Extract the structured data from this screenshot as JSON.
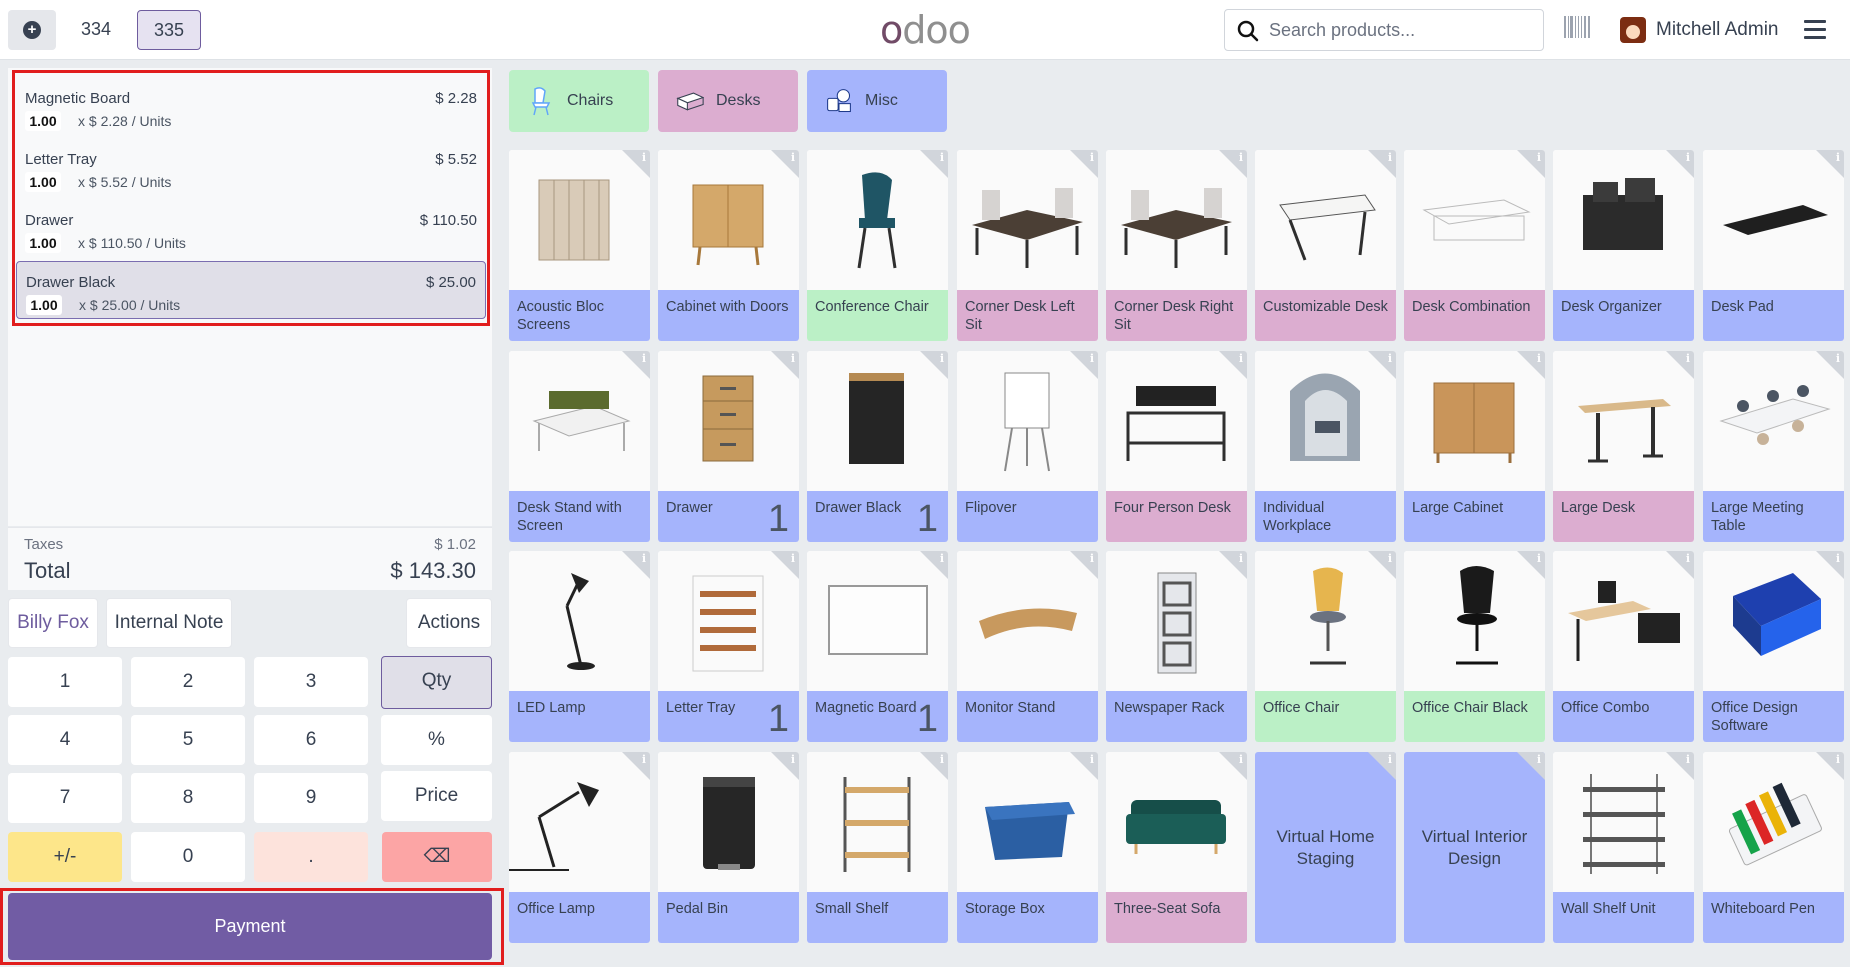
{
  "header": {
    "order_tabs": [
      "334",
      "335"
    ],
    "active_order": "335",
    "logo": "odoo",
    "search_placeholder": "Search products...",
    "user_name": "Mitchell Admin"
  },
  "order_lines": [
    {
      "name": "Magnetic Board",
      "price": "$ 2.28",
      "qty": "1.00",
      "unit_price": "x $ 2.28 / Units",
      "selected": false
    },
    {
      "name": "Letter Tray",
      "price": "$ 5.52",
      "qty": "1.00",
      "unit_price": "x $ 5.52 / Units",
      "selected": false
    },
    {
      "name": "Drawer",
      "price": "$ 110.50",
      "qty": "1.00",
      "unit_price": "x $ 110.50 / Units",
      "selected": false
    },
    {
      "name": "Drawer Black",
      "price": "$ 25.00",
      "qty": "1.00",
      "unit_price": "x $ 25.00 / Units",
      "selected": true
    }
  ],
  "totals": {
    "taxes_label": "Taxes",
    "taxes_value": "$ 1.02",
    "total_label": "Total",
    "total_value": "$ 143.30"
  },
  "controls": {
    "customer": "Billy Fox",
    "internal_note": "Internal Note",
    "actions": "Actions"
  },
  "numpad": {
    "k1": "1",
    "k2": "2",
    "k3": "3",
    "qty": "Qty",
    "k4": "4",
    "k5": "5",
    "k6": "6",
    "percent": "%",
    "k7": "7",
    "k8": "8",
    "k9": "9",
    "price": "Price",
    "plusminus": "+/-",
    "k0": "0",
    "dot": ".",
    "backspace": "⌫"
  },
  "payment_label": "Payment",
  "categories": [
    {
      "name": "Chairs",
      "color": "#bbf0c6"
    },
    {
      "name": "Desks",
      "color": "#dcadd0"
    },
    {
      "name": "Misc",
      "color": "#a5b4fc"
    }
  ],
  "products": [
    {
      "name": "Acoustic Bloc Screens",
      "color": "#a5b4fc"
    },
    {
      "name": "Cabinet with Doors",
      "color": "#a5b4fc"
    },
    {
      "name": "Conference Chair",
      "color": "#bbf0c6"
    },
    {
      "name": "Corner Desk Left Sit",
      "color": "#dcadd0"
    },
    {
      "name": "Corner Desk Right Sit",
      "color": "#dcadd0"
    },
    {
      "name": "Customizable Desk",
      "color": "#dcadd0"
    },
    {
      "name": "Desk Combination",
      "color": "#dcadd0"
    },
    {
      "name": "Desk Organizer",
      "color": "#a5b4fc"
    },
    {
      "name": "Desk Pad",
      "color": "#a5b4fc"
    },
    {
      "name": "Desk Stand with Screen",
      "color": "#a5b4fc"
    },
    {
      "name": "Drawer",
      "color": "#a5b4fc",
      "count": "1"
    },
    {
      "name": "Drawer Black",
      "color": "#a5b4fc",
      "count": "1"
    },
    {
      "name": "Flipover",
      "color": "#a5b4fc"
    },
    {
      "name": "Four Person Desk",
      "color": "#dcadd0"
    },
    {
      "name": "Individual Workplace",
      "color": "#a5b4fc"
    },
    {
      "name": "Large Cabinet",
      "color": "#a5b4fc"
    },
    {
      "name": "Large Desk",
      "color": "#dcadd0"
    },
    {
      "name": "Large Meeting Table",
      "color": "#a5b4fc"
    },
    {
      "name": "LED Lamp",
      "color": "#a5b4fc"
    },
    {
      "name": "Letter Tray",
      "color": "#a5b4fc",
      "count": "1"
    },
    {
      "name": "Magnetic Board",
      "color": "#a5b4fc",
      "count": "1"
    },
    {
      "name": "Monitor Stand",
      "color": "#a5b4fc"
    },
    {
      "name": "Newspaper Rack",
      "color": "#a5b4fc"
    },
    {
      "name": "Office Chair",
      "color": "#bbf0c6"
    },
    {
      "name": "Office Chair Black",
      "color": "#bbf0c6"
    },
    {
      "name": "Office Combo",
      "color": "#a5b4fc"
    },
    {
      "name": "Office Design Software",
      "color": "#a5b4fc"
    },
    {
      "name": "Office Lamp",
      "color": "#a5b4fc"
    },
    {
      "name": "Pedal Bin",
      "color": "#a5b4fc"
    },
    {
      "name": "Small Shelf",
      "color": "#a5b4fc"
    },
    {
      "name": "Storage Box",
      "color": "#a5b4fc"
    },
    {
      "name": "Three-Seat Sofa",
      "color": "#dcadd0"
    },
    {
      "name": "Virtual Home Staging",
      "color": "#a5b4fc",
      "no_image": true
    },
    {
      "name": "Virtual Interior Design",
      "color": "#a5b4fc",
      "no_image": true
    },
    {
      "name": "Wall Shelf Unit",
      "color": "#a5b4fc"
    },
    {
      "name": "Whiteboard Pen",
      "color": "#a5b4fc"
    }
  ],
  "info_glyph": "i"
}
